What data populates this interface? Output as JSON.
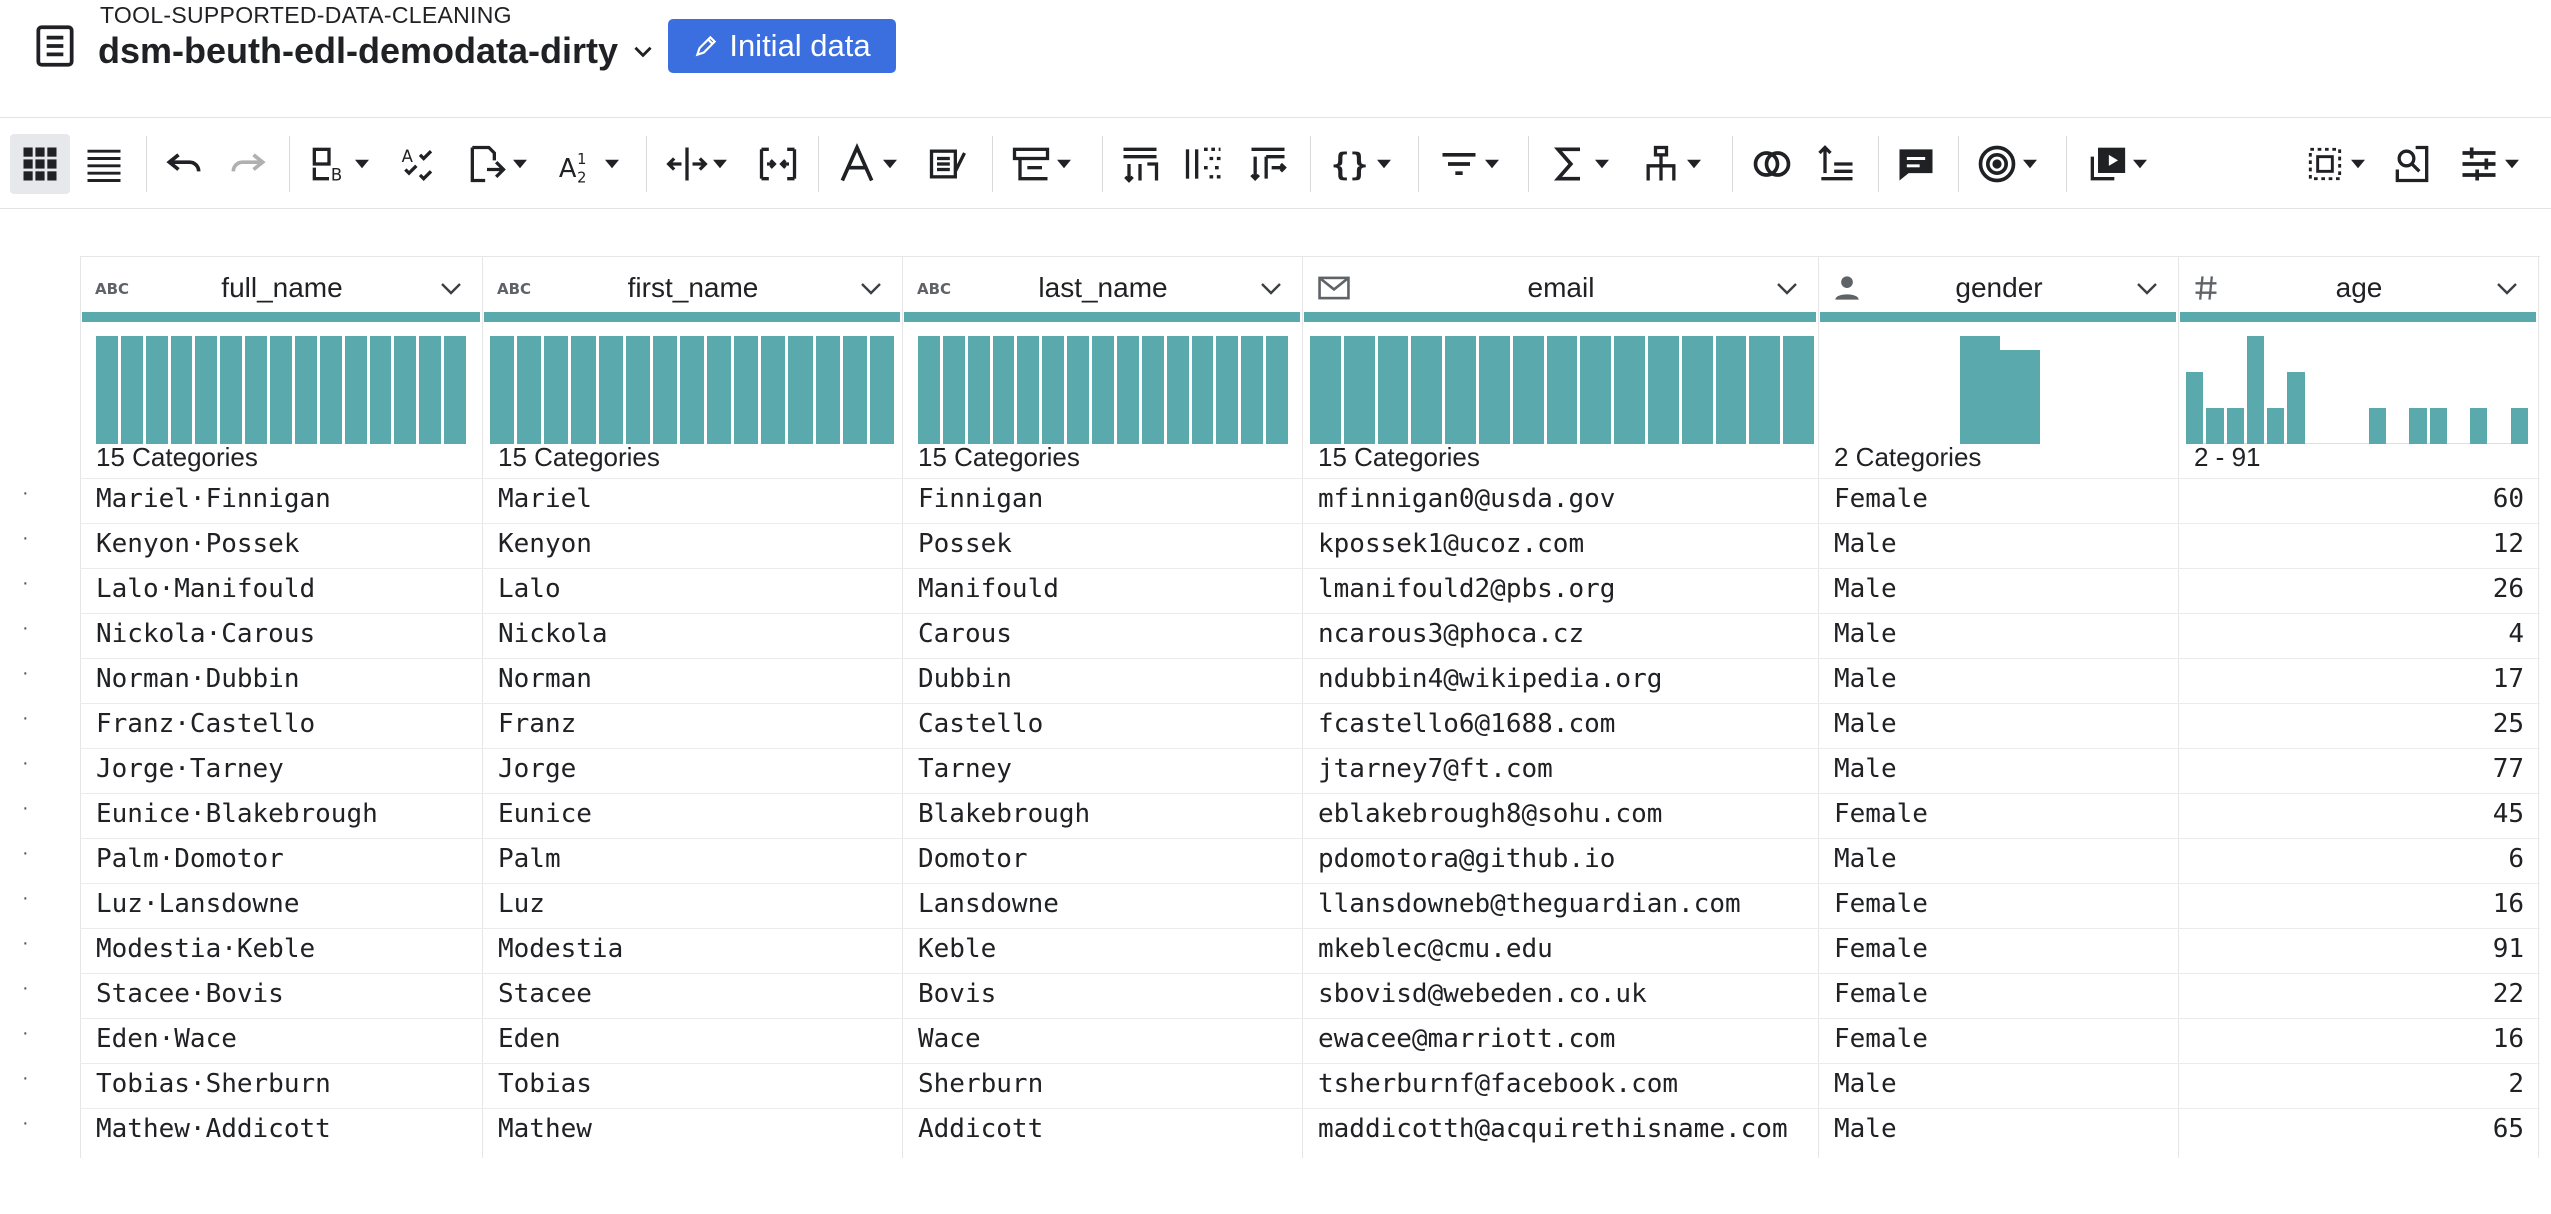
{
  "header": {
    "project_label": "TOOL-SUPPORTED-DATA-CLEANING",
    "dataset_name": "dsm-beuth-edl-demodata-dirty",
    "initial_data_button": "Initial data"
  },
  "toolbar": {
    "icons": [
      "grid-view-icon",
      "list-view-icon",
      "undo-icon",
      "redo-icon",
      "label-type-icon",
      "checklist-icon",
      "fill-icon",
      "sort-icon",
      "split-column-icon",
      "merge-column-icon",
      "text-format-icon",
      "extract-icon",
      "group-icon",
      "filter-rows-icon",
      "split-rows-icon",
      "pivot-icon",
      "json-icon",
      "filter-icon",
      "sum-icon",
      "hierarchy-icon",
      "join-icon",
      "sort-rows-icon",
      "comment-icon",
      "target-icon",
      "copy-icon",
      "select-icon",
      "find-icon",
      "settings-icon"
    ]
  },
  "columns": [
    {
      "name": "full_name",
      "type_icon": "abc-type-icon",
      "summary": "15 Categories"
    },
    {
      "name": "first_name",
      "type_icon": "abc-type-icon",
      "summary": "15 Categories"
    },
    {
      "name": "last_name",
      "type_icon": "abc-type-icon",
      "summary": "15 Categories"
    },
    {
      "name": "email",
      "type_icon": "envelope-icon",
      "summary": "15 Categories"
    },
    {
      "name": "gender",
      "type_icon": "person-icon",
      "summary": "2 Categories"
    },
    {
      "name": "age",
      "type_icon": "hash-icon",
      "summary": "2 - 91"
    }
  ],
  "histograms": {
    "categorical_15": [
      1,
      1,
      1,
      1,
      1,
      1,
      1,
      1,
      1,
      1,
      1,
      1,
      1,
      1,
      1
    ],
    "gender": {
      "categories": [
        "Male",
        "Female"
      ],
      "counts": [
        8,
        7
      ]
    },
    "age_bins": [
      2,
      1,
      1,
      3,
      1,
      2,
      0,
      0,
      0,
      1,
      0,
      1,
      1,
      0,
      1,
      0,
      1
    ]
  },
  "rows": [
    {
      "full_name": "Mariel·Finnigan",
      "first_name": "Mariel",
      "last_name": "Finnigan",
      "email": "mfinnigan0@usda.gov",
      "gender": "Female",
      "age": "60"
    },
    {
      "full_name": "Kenyon·Possek",
      "first_name": "Kenyon",
      "last_name": "Possek",
      "email": "kpossek1@ucoz.com",
      "gender": "Male",
      "age": "12"
    },
    {
      "full_name": "Lalo·Manifould",
      "first_name": "Lalo",
      "last_name": "Manifould",
      "email": "lmanifould2@pbs.org",
      "gender": "Male",
      "age": "26"
    },
    {
      "full_name": "Nickola·Carous",
      "first_name": "Nickola",
      "last_name": "Carous",
      "email": "ncarous3@phoca.cz",
      "gender": "Male",
      "age": "4"
    },
    {
      "full_name": "Norman·Dubbin",
      "first_name": "Norman",
      "last_name": "Dubbin",
      "email": "ndubbin4@wikipedia.org",
      "gender": "Male",
      "age": "17"
    },
    {
      "full_name": "Franz·Castello",
      "first_name": "Franz",
      "last_name": "Castello",
      "email": "fcastello6@1688.com",
      "gender": "Male",
      "age": "25"
    },
    {
      "full_name": "Jorge·Tarney",
      "first_name": "Jorge",
      "last_name": "Tarney",
      "email": "jtarney7@ft.com",
      "gender": "Male",
      "age": "77"
    },
    {
      "full_name": "Eunice·Blakebrough",
      "first_name": "Eunice",
      "last_name": "Blakebrough",
      "email": "eblakebrough8@sohu.com",
      "gender": "Female",
      "age": "45"
    },
    {
      "full_name": "Palm·Domotor",
      "first_name": "Palm",
      "last_name": "Domotor",
      "email": "pdomotora@github.io",
      "gender": "Male",
      "age": "6"
    },
    {
      "full_name": "Luz·Lansdowne",
      "first_name": "Luz",
      "last_name": "Lansdowne",
      "email": "llansdowneb@theguardian.com",
      "gender": "Female",
      "age": "16"
    },
    {
      "full_name": "Modestia·Keble",
      "first_name": "Modestia",
      "last_name": "Keble",
      "email": "mkeblec@cmu.edu",
      "gender": "Female",
      "age": "91"
    },
    {
      "full_name": "Stacee·Bovis",
      "first_name": "Stacee",
      "last_name": "Bovis",
      "email": "sbovisd@webeden.co.uk",
      "gender": "Female",
      "age": "22"
    },
    {
      "full_name": "Eden·Wace",
      "first_name": "Eden",
      "last_name": "Wace",
      "email": "ewacee@marriott.com",
      "gender": "Female",
      "age": "16"
    },
    {
      "full_name": "Tobias·Sherburn",
      "first_name": "Tobias",
      "last_name": "Sherburn",
      "email": "tsherburnf@facebook.com",
      "gender": "Male",
      "age": "2"
    },
    {
      "full_name": "Mathew·Addicott",
      "first_name": "Mathew",
      "last_name": "Addicott",
      "email": "maddicotth@acquirethisname.com",
      "gender": "Male",
      "age": "65"
    }
  ],
  "colors": {
    "accent": "#3b6fe0",
    "histogram": "#5aaaad"
  }
}
